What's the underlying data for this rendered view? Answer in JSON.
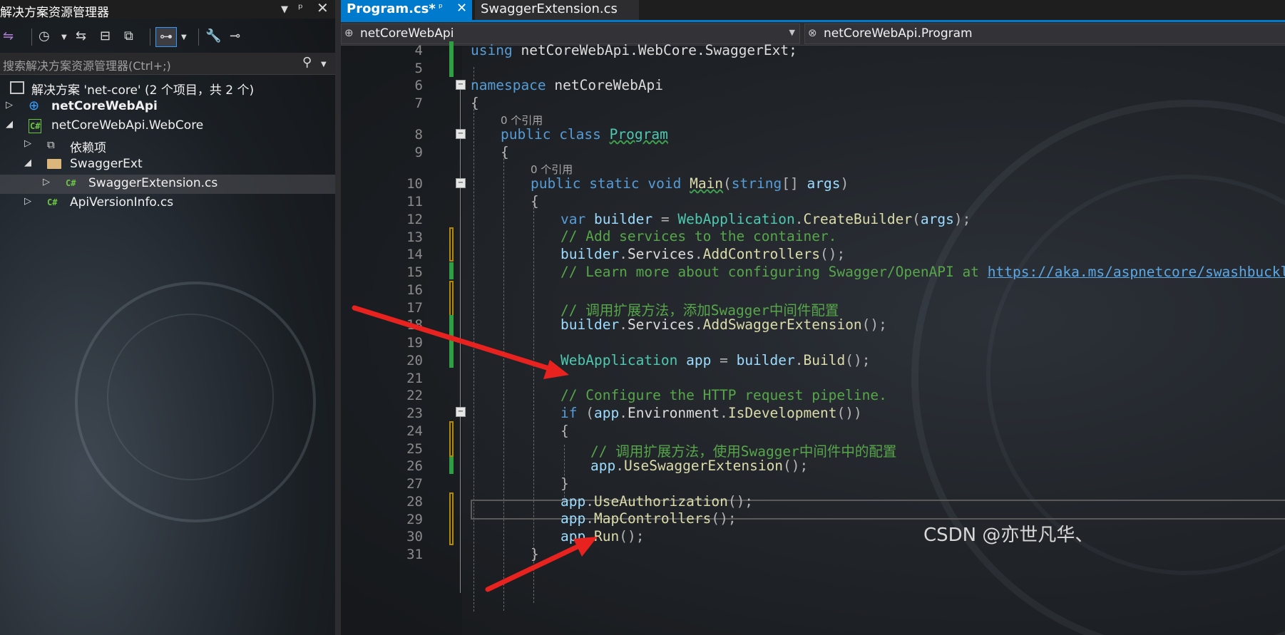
{
  "explorer": {
    "title": "解决方案资源管理器",
    "search_placeholder": "搜索解决方案资源管理器(Ctrl+;)",
    "tree": [
      {
        "label": "解决方案 'net-core' (2 个项目，共 2 个)",
        "icon": "solution-icon"
      },
      {
        "label": "netCoreWebApi",
        "icon": "web-project-icon",
        "bold": true
      },
      {
        "label": "netCoreWebApi.WebCore",
        "icon": "csharp-project-icon"
      },
      {
        "label": "依赖项",
        "icon": "dependencies-icon"
      },
      {
        "label": "SwaggerExt",
        "icon": "folder-icon"
      },
      {
        "label": "SwaggerExtension.cs",
        "icon": "csharp-file-icon",
        "selected": true
      },
      {
        "label": "ApiVersionInfo.cs",
        "icon": "csharp-file-icon"
      }
    ]
  },
  "editor": {
    "tabs": [
      {
        "label": "Program.cs*",
        "active": true
      },
      {
        "label": "SwaggerExtension.cs",
        "active": false
      }
    ],
    "nav": {
      "project": "netCoreWebApi",
      "member": "netCoreWebApi.Program"
    },
    "lens": {
      "line7": "0 个引用",
      "line9": "0 个引用"
    },
    "line_numbers": [
      "4",
      "5",
      "6",
      "7",
      "8",
      "9",
      "10",
      "11",
      "12",
      "13",
      "14",
      "15",
      "16",
      "17",
      "18",
      "19",
      "20",
      "21",
      "22",
      "23",
      "24",
      "25",
      "26",
      "27",
      "28",
      "29",
      "30",
      "31"
    ],
    "code": {
      "l4a": "using ",
      "l4b": "netCoreWebApi.WebCore.SwaggerExt;",
      "l6a": "namespace ",
      "l6b": "netCoreWebApi",
      "l7": "{",
      "l8a": "public ",
      "l8b": "class ",
      "l8c": "Program",
      "l9": "{",
      "l10a": "public ",
      "l10b": "static ",
      "l10c": "void ",
      "l10d": "Main",
      "l10e": "(",
      "l10f": "string",
      "l10g": "[] ",
      "l10h": "args",
      "l10i": ")",
      "l11": "{",
      "l12a": "var ",
      "l12b": "builder",
      "l12c": " = ",
      "l12d": "WebApplication",
      "l12e": ".",
      "l12f": "CreateBuilder",
      "l12g": "(",
      "l12h": "args",
      "l12i": ");",
      "l13": "// Add services to the container.",
      "l14a": "builder",
      "l14b": ".",
      "l14c": "Services",
      "l14d": ".",
      "l14e": "AddControllers",
      "l14f": "();",
      "l15a": "// Learn more about configuring Swagger/OpenAPI at ",
      "l15b": "https://aka.ms/aspnetcore/swashbuckle",
      "l17": "// 调用扩展方法，添加Swagger中间件配置",
      "l18a": "builder",
      "l18b": ".",
      "l18c": "Services",
      "l18d": ".",
      "l18e": "AddSwaggerExtension",
      "l18f": "();",
      "l20a": "WebApplication",
      "l20b": " app",
      "l20c": " = ",
      "l20d": "builder",
      "l20e": ".",
      "l20f": "Build",
      "l20g": "();",
      "l22": "// Configure the HTTP request pipeline.",
      "l23a": "if ",
      "l23b": "(",
      "l23c": "app",
      "l23d": ".",
      "l23e": "Environment",
      "l23f": ".",
      "l23g": "IsDevelopment",
      "l23h": "())",
      "l24": "{",
      "l25": "// 调用扩展方法，使用Swagger中间件中的配置",
      "l26a": "app",
      "l26b": ".",
      "l26c": "UseSwaggerExtension",
      "l26d": "();",
      "l27": "}",
      "l28a": "app",
      "l28b": ".",
      "l28c": "UseAuthorization",
      "l28d": "();",
      "l29a": "app",
      "l29b": ".",
      "l29c": "MapControllers",
      "l29d": "();",
      "l30a": "app",
      "l30b": ".",
      "l30c": "Run",
      "l30d": "();",
      "l31": "}"
    }
  },
  "watermark": "CSDN @亦世凡华、",
  "colors": {
    "accent": "#007acc",
    "annotation_arrow": "#e8231f",
    "keyword": "#569cd6",
    "type": "#4ec9b0",
    "method": "#dcdcaa",
    "comment": "#57a64a"
  }
}
